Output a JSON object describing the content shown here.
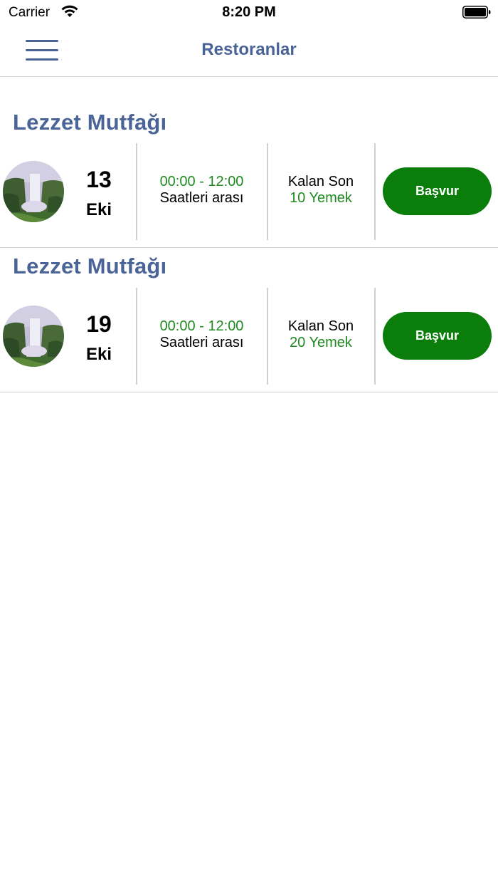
{
  "status_bar": {
    "carrier": "Carrier",
    "time": "8:20 PM",
    "icons": [
      "wifi-icon",
      "battery-icon"
    ]
  },
  "nav": {
    "title": "Restoranlar",
    "menu_icon": "hamburger-menu-icon"
  },
  "colors": {
    "accent": "#4b6497",
    "green_text": "#1f8a1f",
    "button_green": "#0a7d0a",
    "divider": "#d0d0d0"
  },
  "restaurants": [
    {
      "name": "Lezzet Mutfağı",
      "image": "waterfall-photo",
      "day": "13",
      "month": "Eki",
      "time_range": "00:00 - 12:00",
      "time_label": "Saatleri arası",
      "remain_label": "Kalan Son",
      "remain_count": "10 Yemek",
      "button": "Başvur"
    },
    {
      "name": "Lezzet Mutfağı",
      "image": "waterfall-photo",
      "day": "19",
      "month": "Eki",
      "time_range": "00:00 - 12:00",
      "time_label": "Saatleri arası",
      "remain_label": "Kalan Son",
      "remain_count": "20 Yemek",
      "button": "Başvur"
    }
  ]
}
